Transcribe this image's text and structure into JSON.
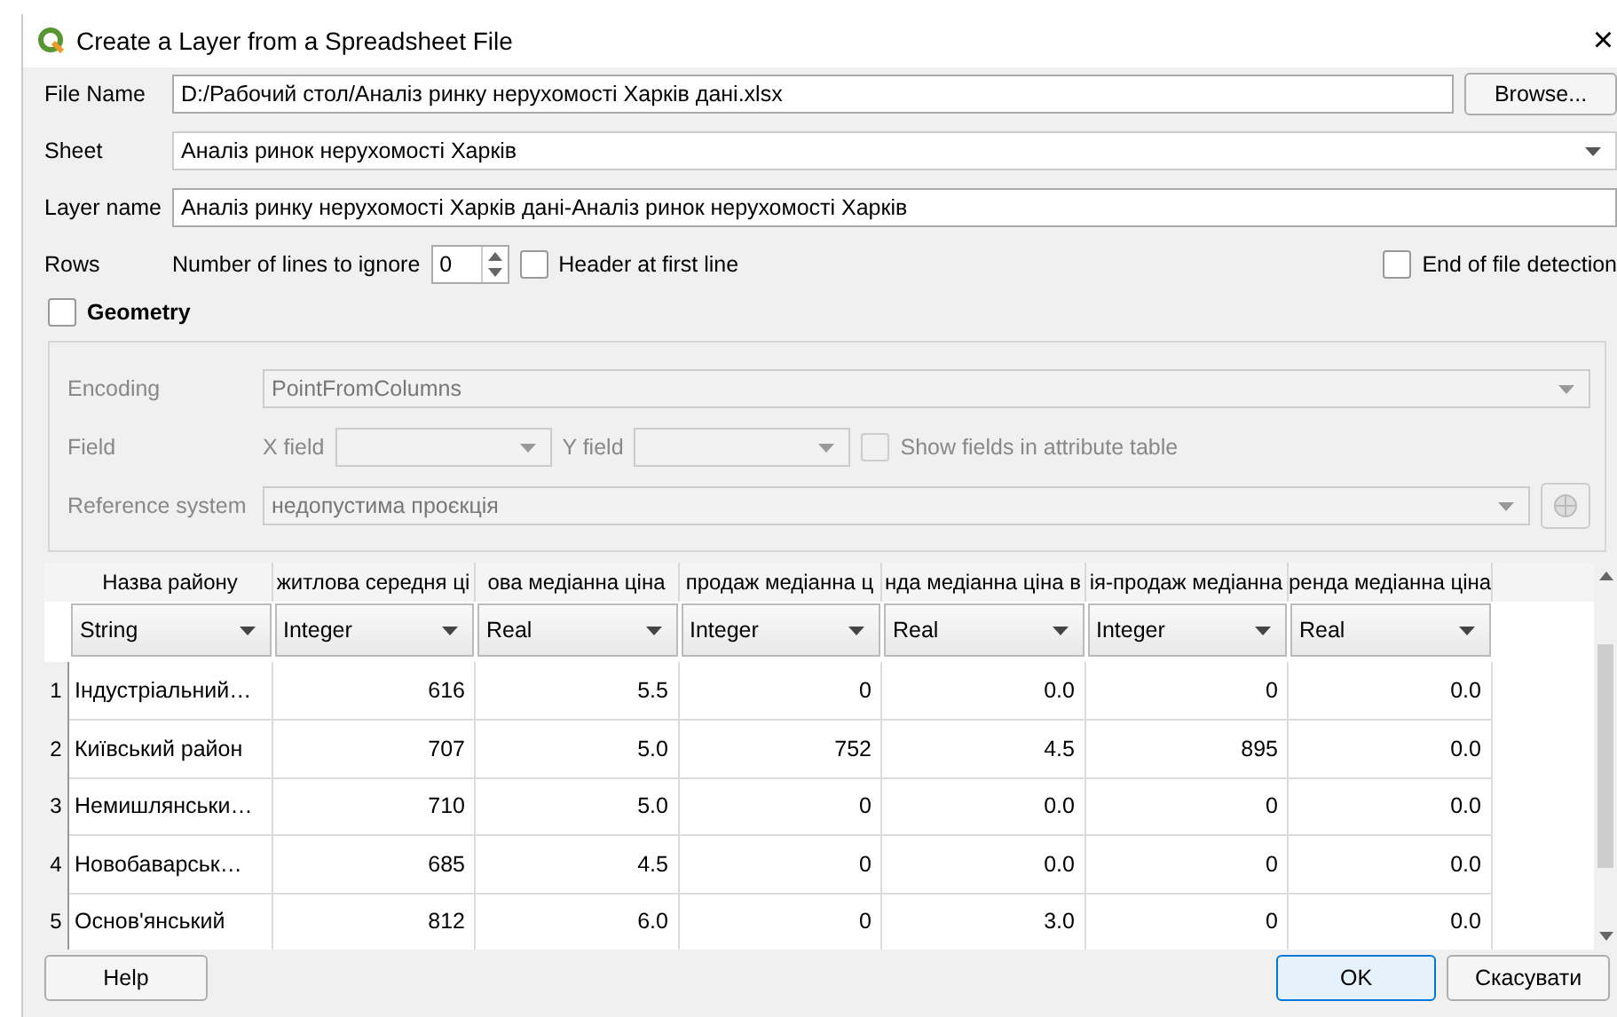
{
  "window": {
    "title": "Create a Layer from a Spreadsheet File",
    "close": "×"
  },
  "file_name": {
    "label": "File Name",
    "value": "D:/Рабочий стол/Аналіз ринку нерухомості Харків дані.xlsx",
    "browse": "Browse..."
  },
  "sheet": {
    "label": "Sheet",
    "value": "Аналіз ринок нерухомості Харків"
  },
  "layer_name": {
    "label": "Layer name",
    "value": "Аналіз ринку нерухомості Харків дані-Аналіз ринок нерухомості Харків"
  },
  "rows": {
    "label": "Rows",
    "ignore_label": "Number of lines to ignore",
    "ignore_value": "0",
    "header_label": "Header at first line",
    "header_checked": false,
    "eof_label": "End of file detection",
    "eof_checked": false
  },
  "geometry": {
    "label": "Geometry",
    "checked": false,
    "encoding_label": "Encoding",
    "encoding": "PointFromColumns",
    "field_label": "Field",
    "x_label": "X field",
    "y_label": "Y field",
    "show_fields_label": "Show fields in attribute table",
    "show_fields_checked": false,
    "crs_label": "Reference system",
    "crs": "недопустима проєкція"
  },
  "table": {
    "columns": [
      {
        "header": "Назва району",
        "type": "String"
      },
      {
        "header": "житлова середня ці",
        "type": "Integer"
      },
      {
        "header": "ова медіанна ціна",
        "type": "Real"
      },
      {
        "header": "продаж медіанна ц",
        "type": "Integer"
      },
      {
        "header": "нда медіанна ціна в",
        "type": "Real"
      },
      {
        "header": "ія-продаж медіанна",
        "type": "Integer"
      },
      {
        "header": "ренда медіанна ціна",
        "type": "Real"
      }
    ],
    "rows": [
      {
        "number": "1",
        "cells": [
          "Індустріальний…",
          "616",
          "5.5",
          "0",
          "0.0",
          "0",
          "0.0"
        ]
      },
      {
        "number": "2",
        "cells": [
          "Київський район",
          "707",
          "5.0",
          "752",
          "4.5",
          "895",
          "0.0"
        ]
      },
      {
        "number": "3",
        "cells": [
          "Немишлянськи…",
          "710",
          "5.0",
          "0",
          "0.0",
          "0",
          "0.0"
        ]
      },
      {
        "number": "4",
        "cells": [
          "Новобаварськ…",
          "685",
          "4.5",
          "0",
          "0.0",
          "0",
          "0.0"
        ]
      },
      {
        "number": "5",
        "cells": [
          "Основ'янський",
          "812",
          "6.0",
          "0",
          "3.0",
          "0",
          "0.0"
        ]
      }
    ]
  },
  "buttons": {
    "help": "Help",
    "ok": "OK",
    "cancel": "Скасувати"
  }
}
